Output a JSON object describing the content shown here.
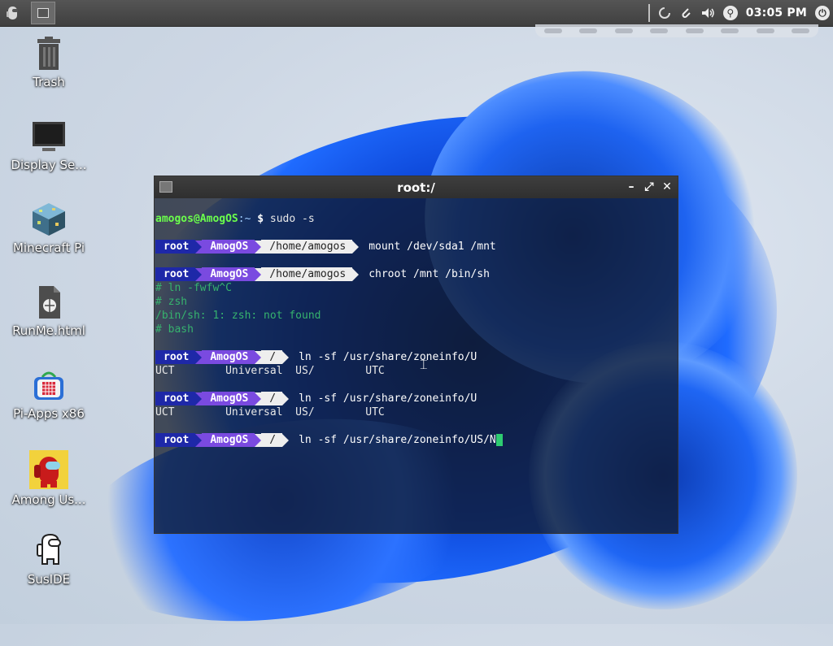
{
  "panel": {
    "time": "03:05 PM"
  },
  "desktop_icons": [
    {
      "label": "Trash"
    },
    {
      "label": "Display Se..."
    },
    {
      "label": "Minecraft Pi"
    },
    {
      "label": "RunMe.html"
    },
    {
      "label": "Pi-Apps x86"
    },
    {
      "label": "Among Us..."
    },
    {
      "label": "SusIDE"
    }
  ],
  "terminal": {
    "title": "root:/",
    "first_prompt": {
      "user": "amogos@AmogOS",
      "path": ":~",
      "dollar": "$",
      "cmd": " sudo -s"
    },
    "prompt_root": "root",
    "prompt_host": "AmogOS",
    "path_home": "/home/amogos",
    "path_root": "/",
    "cmd1": "mount /dev/sda1 /mnt",
    "cmd2": "chroot /mnt /bin/sh",
    "sh_lines": [
      "# ln -fwfw^C",
      "# zsh",
      "/bin/sh: 1: zsh: not found",
      "# bash"
    ],
    "cmd3": "ln -sf /usr/share/zoneinfo/U",
    "completion": "UCT        Universal  US/        UTC",
    "cmd4": "ln -sf /usr/share/zoneinfo/U",
    "cmd5": "ln -sf /usr/share/zoneinfo/US/N"
  },
  "colors": {
    "prompt_root_bg": "#1e28a8",
    "prompt_host_bg": "#7a4ae0",
    "prompt_path_bg": "#eeeeee",
    "cursor": "#2ecc71"
  }
}
